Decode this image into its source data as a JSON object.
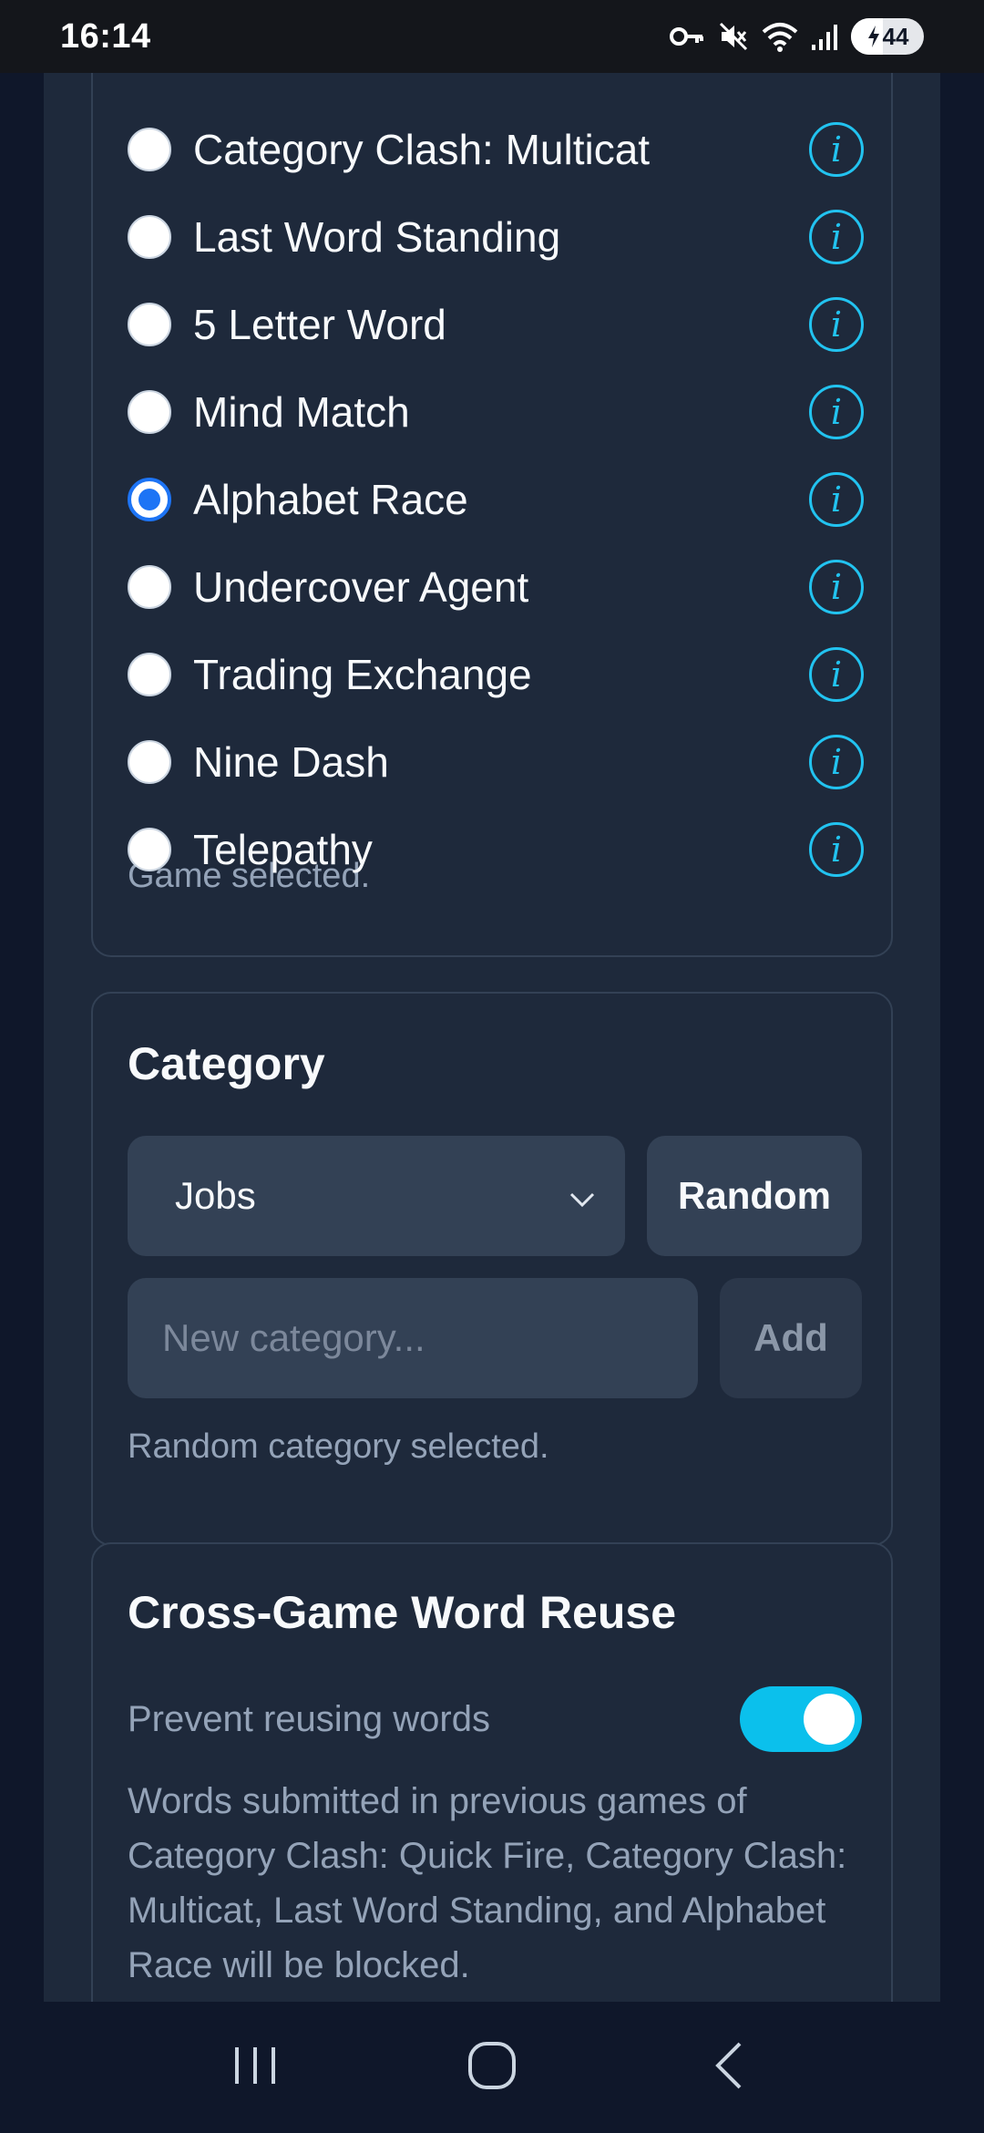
{
  "status_bar": {
    "time": "16:14",
    "battery_level": "44",
    "icons": [
      "vpn-key-icon",
      "mute-icon",
      "wifi-icon",
      "signal-icon",
      "battery-icon"
    ]
  },
  "games": {
    "items": [
      {
        "label": "Category Clash: Multicat",
        "selected": false
      },
      {
        "label": "Last Word Standing",
        "selected": false
      },
      {
        "label": "5 Letter Word",
        "selected": false
      },
      {
        "label": "Mind Match",
        "selected": false
      },
      {
        "label": "Alphabet Race",
        "selected": true
      },
      {
        "label": "Undercover Agent",
        "selected": false
      },
      {
        "label": "Trading Exchange",
        "selected": false
      },
      {
        "label": "Nine Dash",
        "selected": false
      },
      {
        "label": "Telepathy",
        "selected": false
      }
    ],
    "info_glyph": "i",
    "status": "Game selected."
  },
  "category": {
    "title": "Category",
    "selected": "Jobs",
    "random_label": "Random",
    "new_placeholder": "New category...",
    "add_label": "Add",
    "status": "Random category selected."
  },
  "reuse": {
    "title": "Cross-Game Word Reuse",
    "toggle_label": "Prevent reusing words",
    "toggle_on": true,
    "description": "Words submitted in previous games of Category Clash: Quick Fire, Category Clash: Multicat, Last Word Standing, and Alphabet Race will be blocked."
  },
  "colors": {
    "background": "#0f172a",
    "card": "#1e293b",
    "accent": "#22c3f0",
    "toggle": "#0bc0ec",
    "radio_selected": "#1d74f5"
  }
}
